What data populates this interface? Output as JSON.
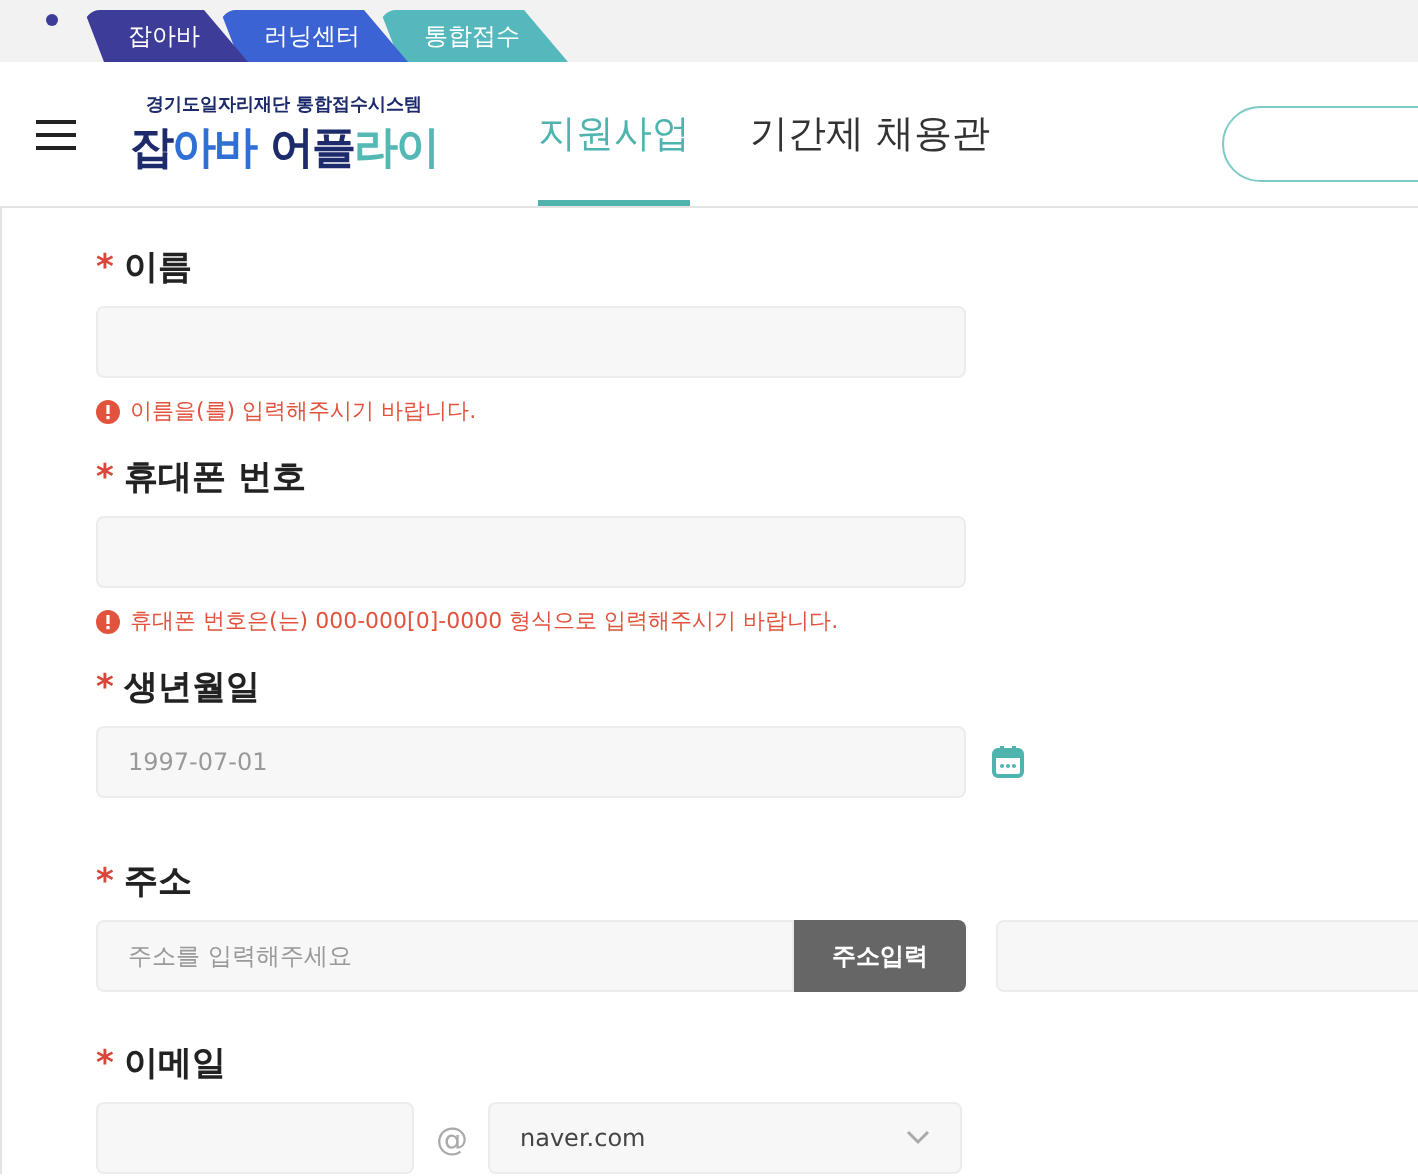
{
  "top_tabs": [
    {
      "label": "잡아바",
      "color": "#3d3d99"
    },
    {
      "label": "러닝센터",
      "color": "#3b63d4"
    },
    {
      "label": "통합접수",
      "color": "#55b8bc"
    }
  ],
  "header": {
    "logo": {
      "caption": "경기도일자리재단 통합접수시스템",
      "parts": [
        {
          "text": "잡",
          "color": "#1d2a6b"
        },
        {
          "text": "아바 ",
          "color": "#2f6fd6"
        },
        {
          "text": "어플",
          "color": "#1d2a6b"
        },
        {
          "text": "라이",
          "color": "#54b8b5"
        }
      ]
    },
    "nav": [
      {
        "label": "지원사업",
        "selected": true
      },
      {
        "label": "기간제 채용관",
        "selected": false
      }
    ]
  },
  "form": {
    "fields": [
      {
        "kind": "text",
        "mark": "*",
        "label": "이름",
        "error": "이름을(를) 입력해주시기 바랍니다."
      },
      {
        "kind": "text",
        "mark": "*",
        "label": "휴대폰 번호",
        "error": "휴대폰 번호은(는) 000-000[0]-0000 형식으로 입력해주시기 바랍니다."
      },
      {
        "kind": "date",
        "mark": "*",
        "label": "생년월일",
        "value": "1997-07-01"
      },
      {
        "kind": "address",
        "mark": "*",
        "label": "주소",
        "placeholder": "주소를 입력해주세요",
        "button": "주소입력"
      },
      {
        "kind": "email",
        "mark": "*",
        "label": "이메일",
        "at": "@",
        "domain": "naver.com"
      }
    ]
  }
}
